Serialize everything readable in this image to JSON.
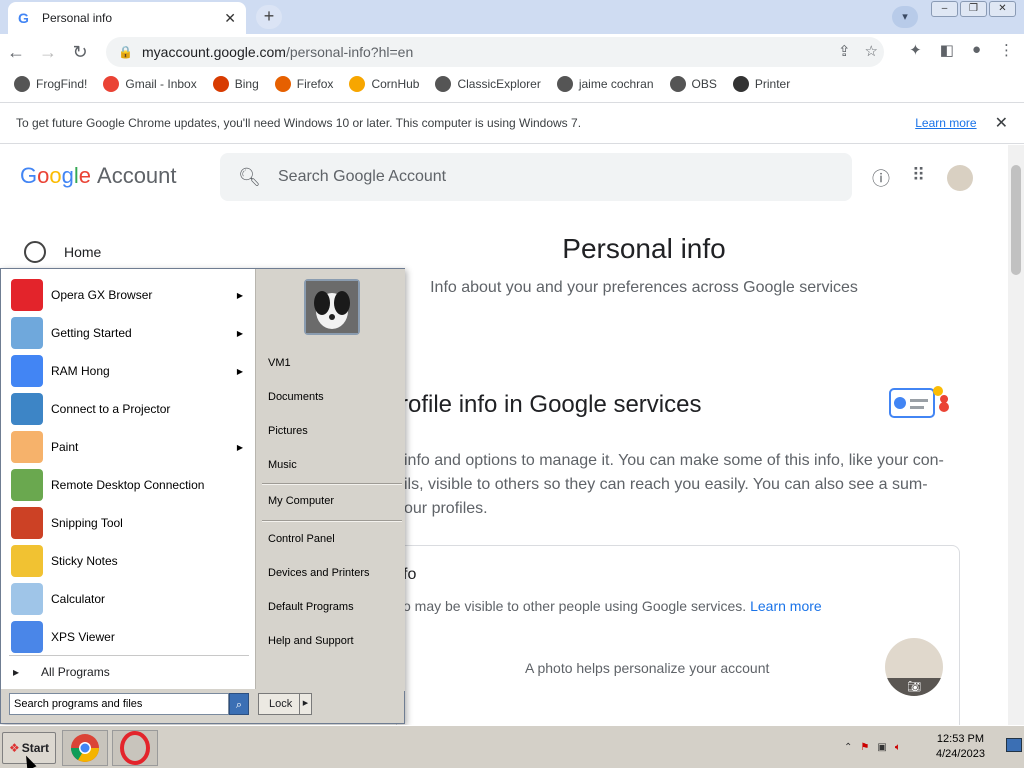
{
  "browser": {
    "tab_title": "Personal info",
    "tab_favicon": "G",
    "url_host": "myaccount.google.com",
    "url_path": "/personal-info?hl=en"
  },
  "bookmarks": [
    {
      "label": "FrogFind!",
      "icon": "globe-icon",
      "color": "#555555"
    },
    {
      "label": "Gmail - Inbox",
      "icon": "gmail-icon",
      "color": "#ea4335"
    },
    {
      "label": "Bing",
      "icon": "bing-icon",
      "color": "#d83b01"
    },
    {
      "label": "Firefox",
      "icon": "firefox-icon",
      "color": "#e66000"
    },
    {
      "label": "CornHub",
      "icon": "cornhub-icon",
      "color": "#f7a600"
    },
    {
      "label": "ClassicExplorer",
      "icon": "globe-icon",
      "color": "#555555"
    },
    {
      "label": "jaime cochran",
      "icon": "globe-icon",
      "color": "#555555"
    },
    {
      "label": "OBS",
      "icon": "globe-icon",
      "color": "#555555"
    },
    {
      "label": "Printer",
      "icon": "cups-icon",
      "color": "#333333"
    }
  ],
  "infobar": {
    "message": "To get future Google Chrome updates, you'll need Windows 10 or later. This computer is using Windows 7.",
    "link": "Learn more"
  },
  "google": {
    "logo": "Google",
    "logo_suffix": "Account",
    "search_placeholder": "Search Google Account",
    "home": "Home",
    "title": "Personal info",
    "subtitle": "Info about you and your preferences across Google services",
    "profile_heading": "rofile info in Google services",
    "profile_text_1": "info and options to manage it. You can make some of this info, like your con-",
    "profile_text_2": "ils, visible to others so they can reach you easily. You can also see a sum-",
    "profile_text_3": "our profiles.",
    "card_heading": "fo",
    "card_sub": "o may be visible to other people using Google services.",
    "card_link": "Learn more",
    "photo_text": "A photo helps personalize your account"
  },
  "startmenu": {
    "left_items": [
      {
        "label": "Opera GX Browser",
        "icon": "opera-icon",
        "arrow": true
      },
      {
        "label": "Getting Started",
        "icon": "getting-started-icon",
        "arrow": true
      },
      {
        "label": "RAM Hong",
        "icon": "chrome-icon",
        "arrow": true
      },
      {
        "label": "Connect to a Projector",
        "icon": "projector-icon",
        "arrow": false
      },
      {
        "label": "Paint",
        "icon": "paint-icon",
        "arrow": true
      },
      {
        "label": "Remote Desktop Connection",
        "icon": "remote-desktop-icon",
        "arrow": false
      },
      {
        "label": "Snipping Tool",
        "icon": "scissors-icon",
        "arrow": false
      },
      {
        "label": "Sticky Notes",
        "icon": "sticky-notes-icon",
        "arrow": false
      },
      {
        "label": "Calculator",
        "icon": "calculator-icon",
        "arrow": false
      },
      {
        "label": "XPS Viewer",
        "icon": "xps-icon",
        "arrow": false
      }
    ],
    "all_programs": "All Programs",
    "right_items": [
      "VM1",
      "Documents",
      "Pictures",
      "Music",
      "My Computer",
      "Control Panel",
      "Devices and Printers",
      "Default Programs",
      "Help and Support"
    ],
    "search_placeholder": "Search programs and files",
    "lock": "Lock"
  },
  "taskbar": {
    "start": "Start",
    "time": "12:53 PM",
    "date": "4/24/2023"
  }
}
